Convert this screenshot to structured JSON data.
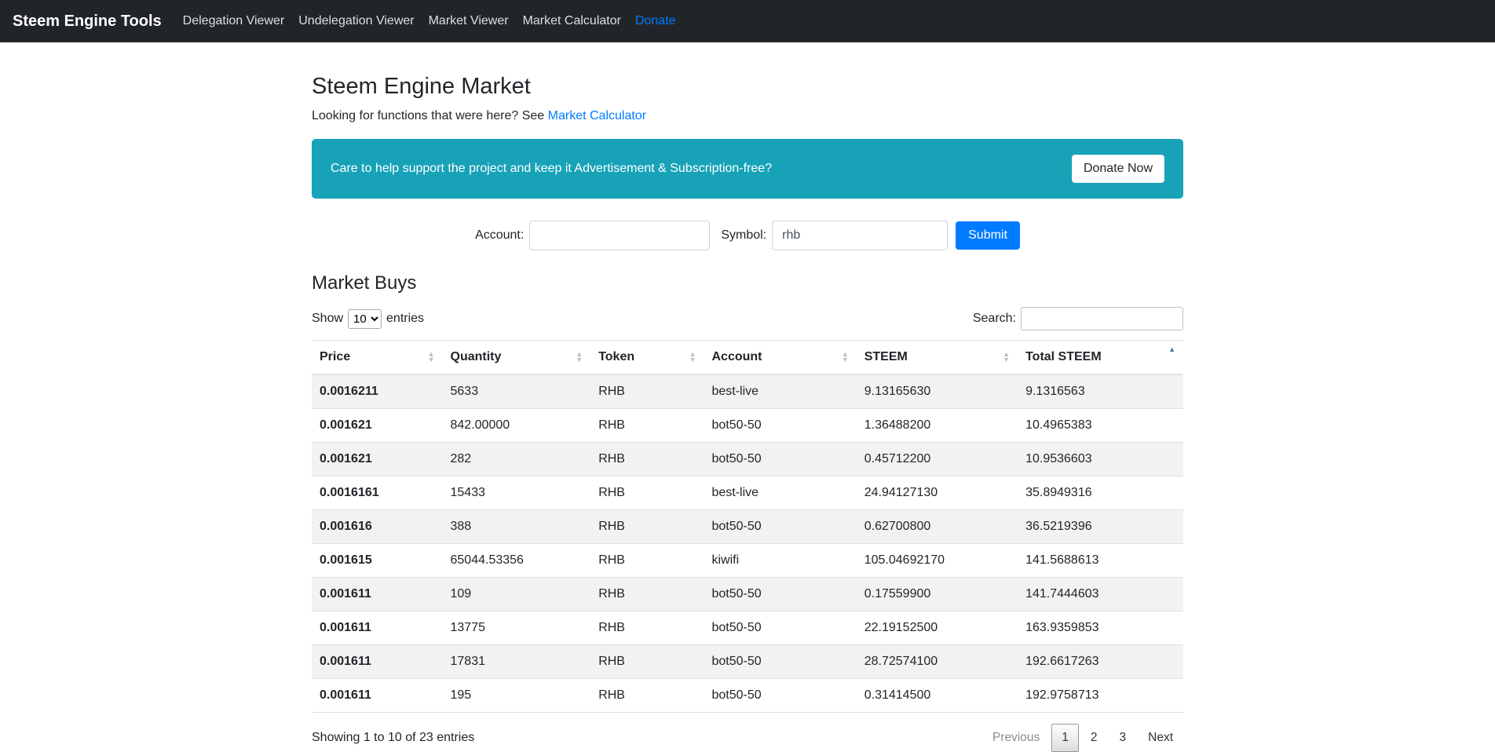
{
  "colors": {
    "navbar_bg": "#212529",
    "accent_blue": "#007bff",
    "banner_bg": "#17a2b8",
    "sort_active": "#3d76c9"
  },
  "navbar": {
    "brand": "Steem Engine Tools",
    "items": [
      {
        "label": "Delegation Viewer"
      },
      {
        "label": "Undelegation Viewer"
      },
      {
        "label": "Market Viewer"
      },
      {
        "label": "Market Calculator"
      },
      {
        "label": "Donate"
      }
    ]
  },
  "page": {
    "title": "Steem Engine Market",
    "subtitle_prefix": "Looking for functions that were here? See ",
    "subtitle_link": "Market Calculator"
  },
  "banner": {
    "text": "Care to help support the project and keep it Advertisement & Subscription-free?",
    "button_label": "Donate Now"
  },
  "form": {
    "account_label": "Account:",
    "account_value": "",
    "symbol_label": "Symbol:",
    "symbol_value": "rhb",
    "submit_label": "Submit"
  },
  "market_buys": {
    "title": "Market Buys",
    "show_prefix": "Show",
    "show_suffix": "entries",
    "page_length": "10",
    "search_label": "Search:",
    "search_value": "",
    "columns": [
      "Price",
      "Quantity",
      "Token",
      "Account",
      "STEEM",
      "Total STEEM"
    ],
    "sorted_column": "Total STEEM",
    "sort_direction": "asc",
    "rows": [
      [
        "0.0016211",
        "5633",
        "RHB",
        "best-live",
        "9.13165630",
        "9.1316563"
      ],
      [
        "0.001621",
        "842.00000",
        "RHB",
        "bot50-50",
        "1.36488200",
        "10.4965383"
      ],
      [
        "0.001621",
        "282",
        "RHB",
        "bot50-50",
        "0.45712200",
        "10.9536603"
      ],
      [
        "0.0016161",
        "15433",
        "RHB",
        "best-live",
        "24.94127130",
        "35.8949316"
      ],
      [
        "0.001616",
        "388",
        "RHB",
        "bot50-50",
        "0.62700800",
        "36.5219396"
      ],
      [
        "0.001615",
        "65044.53356",
        "RHB",
        "kiwifi",
        "105.04692170",
        "141.5688613"
      ],
      [
        "0.001611",
        "109",
        "RHB",
        "bot50-50",
        "0.17559900",
        "141.7444603"
      ],
      [
        "0.001611",
        "13775",
        "RHB",
        "bot50-50",
        "22.19152500",
        "163.9359853"
      ],
      [
        "0.001611",
        "17831",
        "RHB",
        "bot50-50",
        "28.72574100",
        "192.6617263"
      ],
      [
        "0.001611",
        "195",
        "RHB",
        "bot50-50",
        "0.31414500",
        "192.9758713"
      ]
    ],
    "info_text": "Showing 1 to 10 of 23 entries",
    "pagination": {
      "previous_label": "Previous",
      "pages": [
        "1",
        "2",
        "3"
      ],
      "current_page": "1",
      "next_label": "Next"
    }
  }
}
